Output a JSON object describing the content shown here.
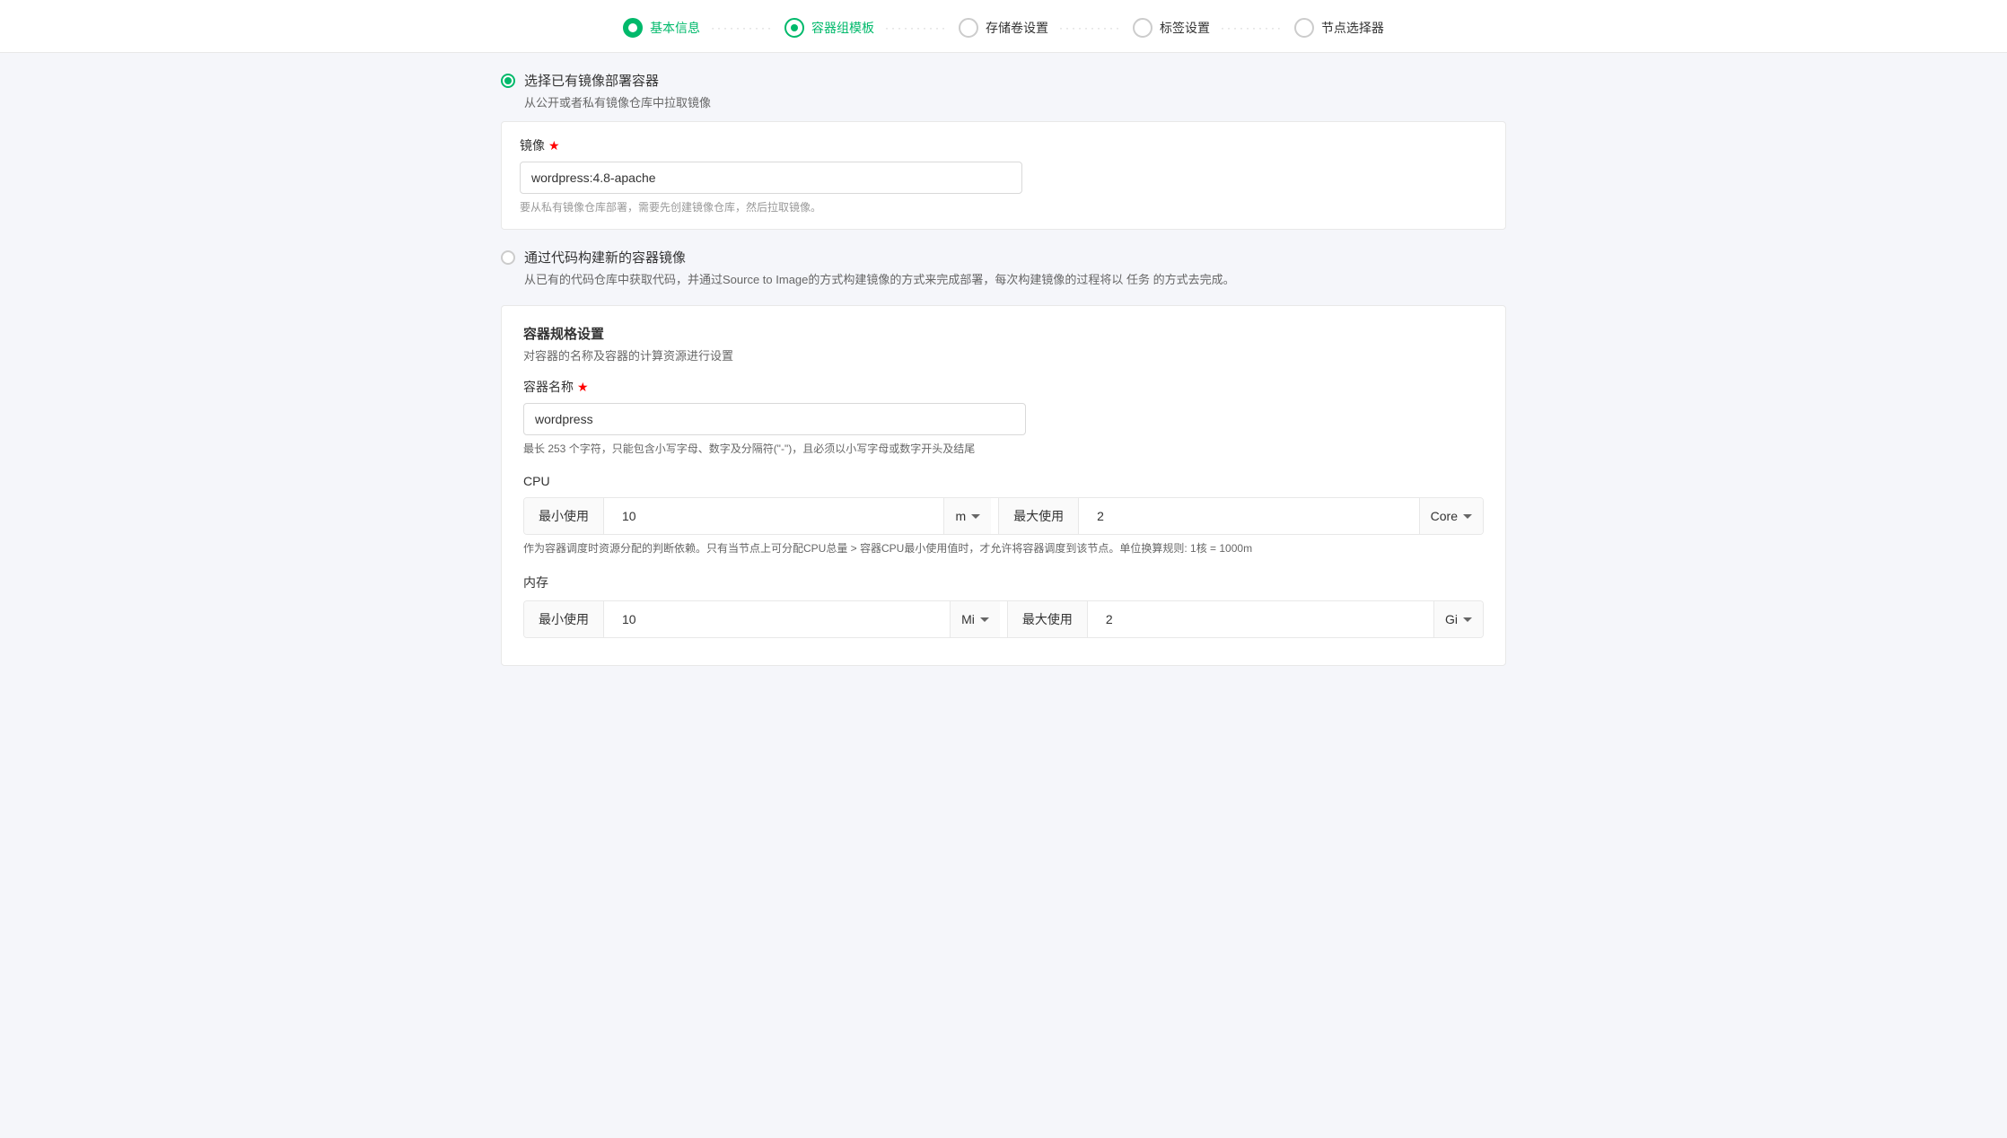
{
  "stepper": {
    "steps": [
      {
        "id": "basic",
        "label": "基本信息",
        "state": "active"
      },
      {
        "id": "container",
        "label": "容器组模板",
        "state": "current"
      },
      {
        "id": "storage",
        "label": "存储卷设置",
        "state": "inactive"
      },
      {
        "id": "tags",
        "label": "标签设置",
        "state": "inactive"
      },
      {
        "id": "node",
        "label": "节点选择器",
        "state": "inactive"
      }
    ]
  },
  "deploy_from_image": {
    "radio_label": "选择已有镜像部署容器",
    "radio_desc": "从公开或者私有镜像仓库中拉取镜像",
    "image_label": "镜像",
    "image_value": "wordpress:4.8-apache",
    "image_hint": "要从私有镜像仓库部署，需要先创建镜像仓库，然后拉取镜像。"
  },
  "deploy_from_code": {
    "radio_label": "通过代码构建新的容器镜像",
    "radio_desc": "从已有的代码仓库中获取代码，并通过Source to Image的方式构建镜像的方式来完成部署，每次构建镜像的过程将以 任务 的方式去完成。"
  },
  "container_spec": {
    "section_title": "容器规格设置",
    "section_desc": "对容器的名称及容器的计算资源进行设置",
    "name_label": "容器名称",
    "name_value": "wordpress",
    "name_hint": "最长 253 个字符，只能包含小写字母、数字及分隔符(\"-\")，且必须以小写字母或数字开头及结尾",
    "cpu_label": "CPU",
    "cpu_min_label": "最小使用",
    "cpu_min_value": "10",
    "cpu_min_unit": "m",
    "cpu_max_label": "最大使用",
    "cpu_max_value": "2",
    "cpu_max_unit": "Core",
    "cpu_hint": "作为容器调度时资源分配的判断依赖。只有当节点上可分配CPU总量 > 容器CPU最小使用值时，才允许将容器调度到该节点。单位换算规则: 1核 = 1000m",
    "mem_label": "内存",
    "mem_min_label": "最小使用",
    "mem_min_value": "10",
    "mem_min_unit": "Mi",
    "mem_max_label": "最大使用",
    "mem_max_value": "2",
    "mem_max_unit": "Gi"
  }
}
